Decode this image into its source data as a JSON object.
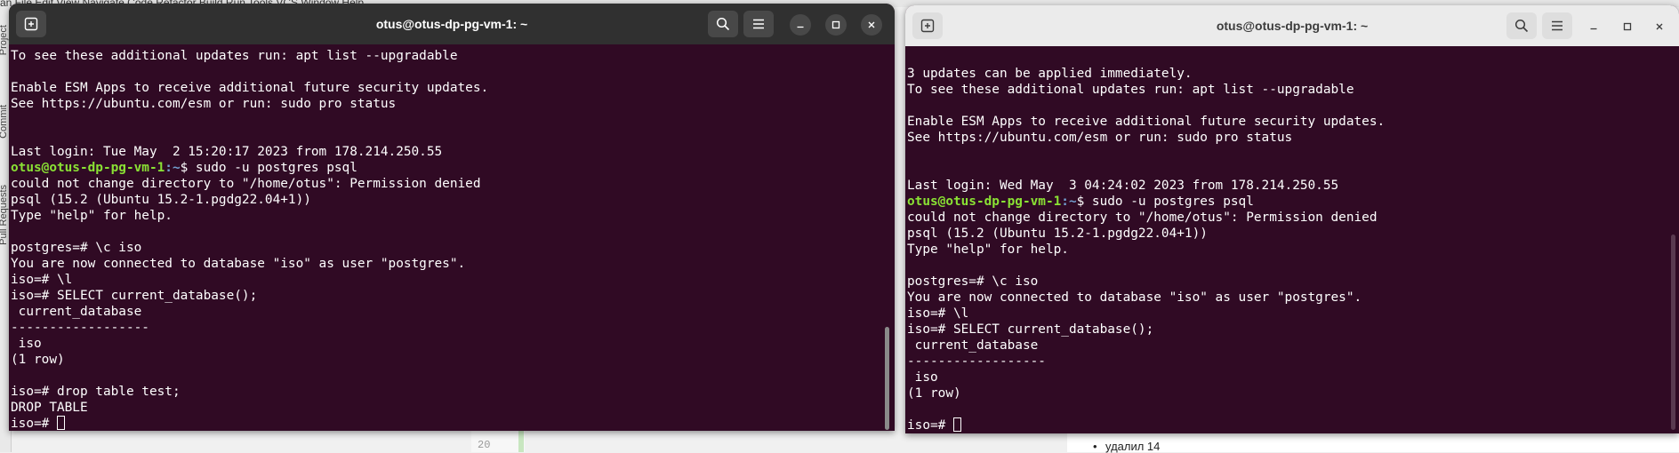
{
  "background": {
    "top_text": "an    File  Edit  View  Navigate  Code  Refactor  Build  Run  Tools  VCS  Window  Help",
    "ide_tabs": [
      "Project",
      "Commit",
      "Pull Requests"
    ],
    "editor_line_number": "20",
    "doc_bullet": "удалил 14"
  },
  "left_window": {
    "title": "otus@otus-dp-pg-vm-1: ~",
    "lines": [
      {
        "text": "To see these additional updates run: apt list --upgradable"
      },
      {
        "text": ""
      },
      {
        "text": "Enable ESM Apps to receive additional future security updates."
      },
      {
        "text": "See https://ubuntu.com/esm or run: sudo pro status"
      },
      {
        "text": ""
      },
      {
        "text": ""
      },
      {
        "text": "Last login: Tue May  2 15:20:17 2023 from 178.214.250.55"
      },
      {
        "prompt_user": "otus@otus-dp-pg-vm-1",
        "prompt_path": ":~",
        "text": "$ sudo -u postgres psql"
      },
      {
        "text": "could not change directory to \"/home/otus\": Permission denied"
      },
      {
        "text": "psql (15.2 (Ubuntu 15.2-1.pgdg22.04+1))"
      },
      {
        "text": "Type \"help\" for help."
      },
      {
        "text": ""
      },
      {
        "text": "postgres=# \\c iso"
      },
      {
        "text": "You are now connected to database \"iso\" as user \"postgres\"."
      },
      {
        "text": "iso=# \\l"
      },
      {
        "text": "iso=# SELECT current_database();"
      },
      {
        "text": " current_database"
      },
      {
        "text": "------------------"
      },
      {
        "text": " iso"
      },
      {
        "text": "(1 row)"
      },
      {
        "text": ""
      },
      {
        "text": "iso=# drop table test;"
      },
      {
        "text": "DROP TABLE"
      },
      {
        "text": "iso=# ",
        "cursor": true
      }
    ]
  },
  "right_window": {
    "title": "otus@otus-dp-pg-vm-1: ~",
    "lines": [
      {
        "text": ""
      },
      {
        "text": "3 updates can be applied immediately."
      },
      {
        "text": "To see these additional updates run: apt list --upgradable"
      },
      {
        "text": ""
      },
      {
        "text": "Enable ESM Apps to receive additional future security updates."
      },
      {
        "text": "See https://ubuntu.com/esm or run: sudo pro status"
      },
      {
        "text": ""
      },
      {
        "text": ""
      },
      {
        "text": "Last login: Wed May  3 04:24:02 2023 from 178.214.250.55"
      },
      {
        "prompt_user": "otus@otus-dp-pg-vm-1",
        "prompt_path": ":~",
        "text": "$ sudo -u postgres psql"
      },
      {
        "text": "could not change directory to \"/home/otus\": Permission denied"
      },
      {
        "text": "psql (15.2 (Ubuntu 15.2-1.pgdg22.04+1))"
      },
      {
        "text": "Type \"help\" for help."
      },
      {
        "text": ""
      },
      {
        "text": "postgres=# \\c iso"
      },
      {
        "text": "You are now connected to database \"iso\" as user \"postgres\"."
      },
      {
        "text": "iso=# \\l"
      },
      {
        "text": "iso=# SELECT current_database();"
      },
      {
        "text": " current_database"
      },
      {
        "text": "------------------"
      },
      {
        "text": " iso"
      },
      {
        "text": "(1 row)"
      },
      {
        "text": ""
      },
      {
        "text": "iso=# ",
        "cursor": true
      }
    ]
  },
  "icons": {
    "new_tab": "new-tab-icon",
    "search": "search-icon",
    "menu": "hamburger-menu-icon",
    "minimize": "minimize-icon",
    "maximize": "maximize-icon",
    "close": "close-icon"
  },
  "colors": {
    "terminal_bg": "#300a24",
    "prompt_user": "#8ae234",
    "prompt_path": "#729fcf",
    "titlebar_dark": "#303030",
    "titlebar_light": "#ebebeb"
  }
}
